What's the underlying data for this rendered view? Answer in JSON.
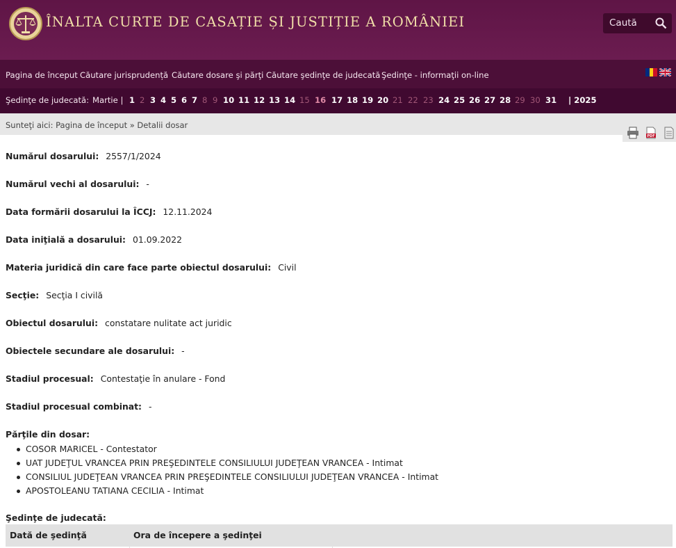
{
  "header": {
    "site_title": "ÎNALTA CURTE DE CASAȚIE ȘI JUSTIȚIE A ROMÂNIEI",
    "search_label": "Caută",
    "accent": "#5f1546",
    "gold": "#f1dfa8"
  },
  "nav": {
    "items": [
      "Pagina de început",
      "Căutare jurisprudență",
      "Căutare dosare şi părţi",
      "Căutare şedinţe de judecată",
      "Şedinţe - informaţii on-line"
    ]
  },
  "calendar": {
    "label": "Şedinţe de judecată:",
    "month": "Martie |",
    "days": [
      "1",
      "2",
      "3",
      "4",
      "5",
      "6",
      "7",
      "8",
      "9",
      "10",
      "11",
      "12",
      "13",
      "14",
      "15",
      "16",
      "17",
      "18",
      "19",
      "20",
      "21",
      "22",
      "23",
      "24",
      "25",
      "26",
      "27",
      "28",
      "29",
      "30",
      "31"
    ],
    "year": "| 2025"
  },
  "breadcrumb": "Sunteţi aici: Pagina de început » Detalii dosar",
  "fields": [
    {
      "label": "Numărul dosarului:",
      "value": "2557/1/2024"
    },
    {
      "label": "Numărul vechi al dosarului:",
      "value": "-"
    },
    {
      "label": "Data formării dosarului la ÎCCJ:",
      "value": "12.11.2024"
    },
    {
      "label": "Data iniţială a dosarului:",
      "value": "01.09.2022"
    },
    {
      "label": "Materia juridică din care face parte obiectul dosarului:",
      "value": "Civil"
    },
    {
      "label": "Secţie:",
      "value": "Secţia I civilă"
    },
    {
      "label": "Obiectul dosarului:",
      "value": "constatare nulitate act juridic"
    },
    {
      "label": "Obiectele secundare ale dosarului:",
      "value": "-"
    },
    {
      "label": "Stadiul procesual:",
      "value": "Contestaţie în anulare - Fond"
    },
    {
      "label": "Stadiul procesual combinat:",
      "value": "-"
    }
  ],
  "parties": {
    "label": "Părţile din dosar:",
    "items": [
      "COSOR MARICEL - Contestator",
      "UAT JUDEŢUL VRANCEA PRIN PREŞEDINTELE CONSILIULUI JUDEŢEAN VRANCEA - Intimat",
      "CONSILIUL JUDEŢEAN VRANCEA PRIN PREŞEDINTELE CONSILIULUI JUDEŢEAN VRANCEA - Intimat",
      "APOSTOLEANU TATIANA CECILIA - Intimat"
    ]
  },
  "hearings": {
    "label": "Şedinţe de judecată:",
    "columns": [
      "Dată de şedinţă",
      "Ora de începere a şedinţei",
      ""
    ]
  }
}
